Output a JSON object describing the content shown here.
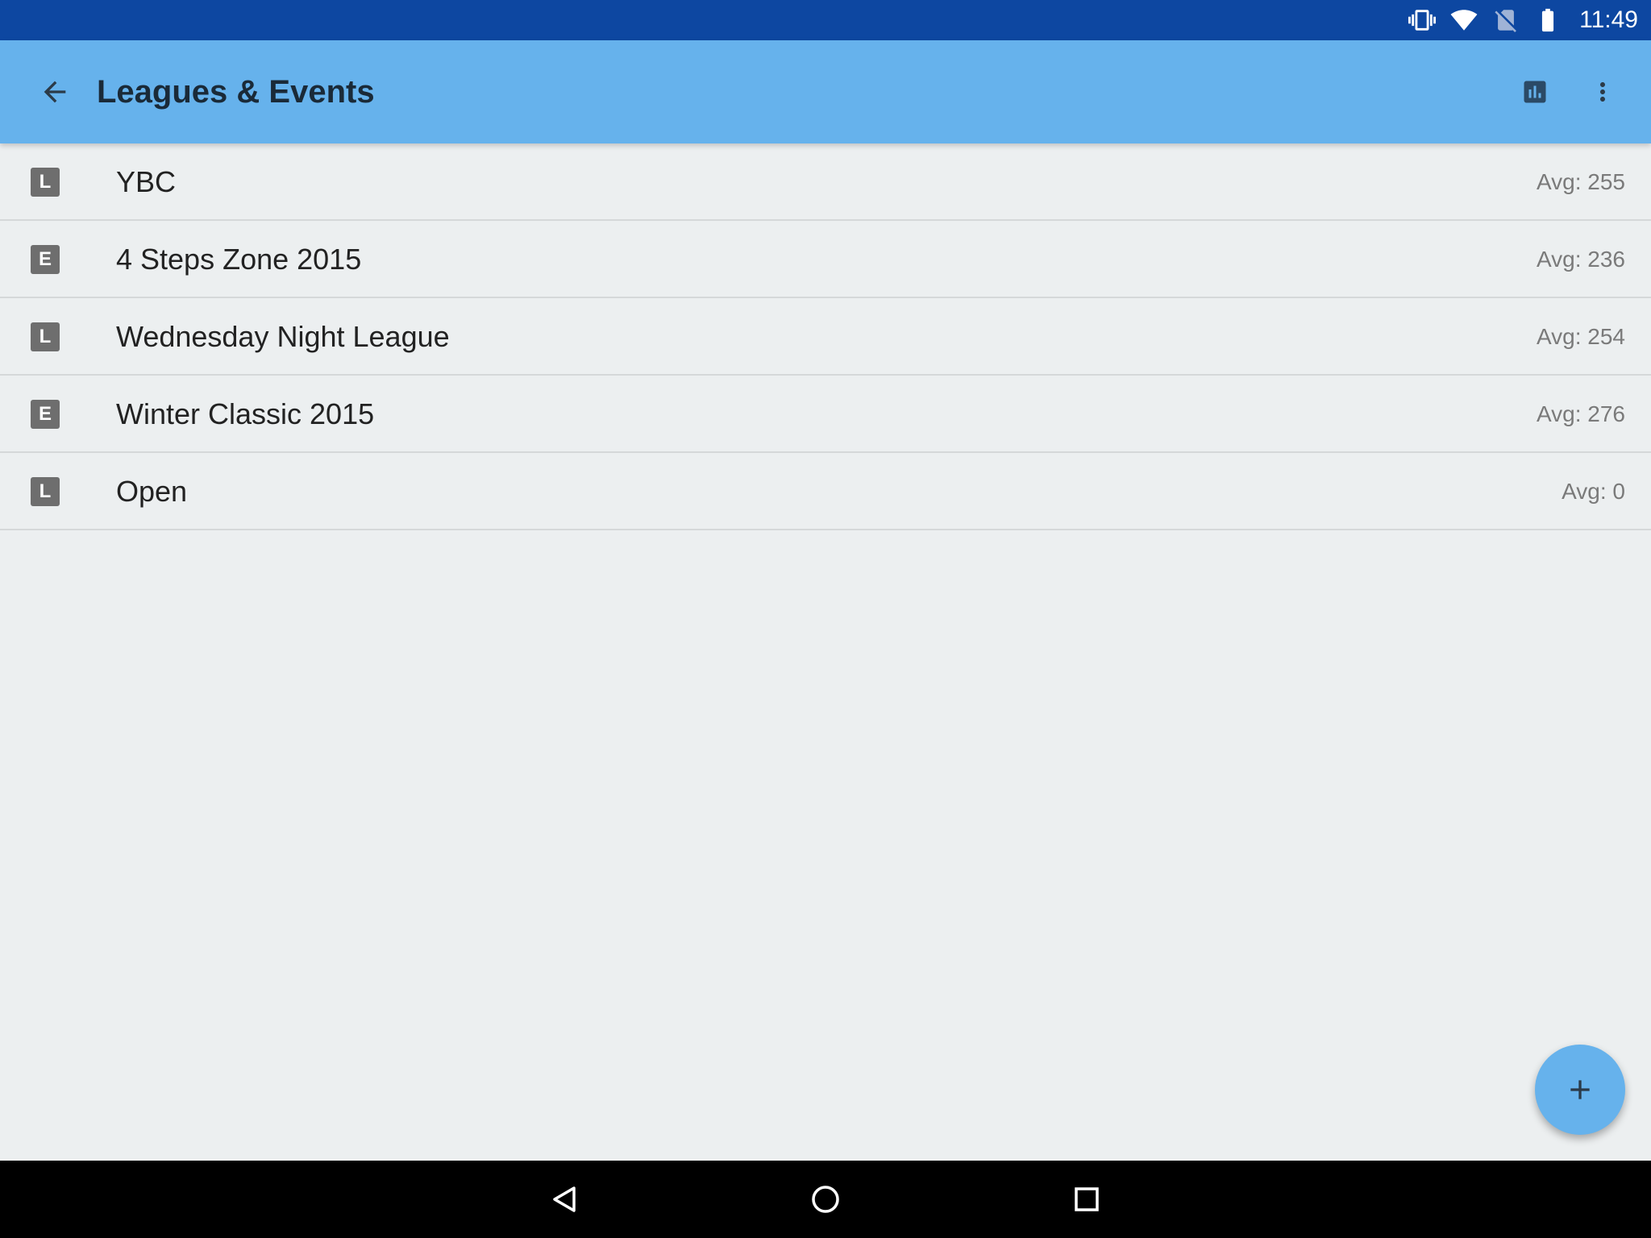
{
  "status_bar": {
    "time": "11:49",
    "icons": [
      "vibrate-icon",
      "wifi-icon",
      "no-sim-icon",
      "battery-icon"
    ],
    "background": "#0D47A1"
  },
  "app_bar": {
    "title": "Leagues & Events",
    "back_icon": "arrow-back-icon",
    "actions": [
      "stats-icon",
      "more-vert-icon"
    ],
    "background": "#66B2EC"
  },
  "items": [
    {
      "type": "L",
      "name": "YBC",
      "avg": "Avg: 255"
    },
    {
      "type": "E",
      "name": "4 Steps Zone 2015",
      "avg": "Avg: 236"
    },
    {
      "type": "L",
      "name": "Wednesday Night League",
      "avg": "Avg: 254"
    },
    {
      "type": "E",
      "name": "Winter Classic 2015",
      "avg": "Avg: 276"
    },
    {
      "type": "L",
      "name": "Open",
      "avg": "Avg: 0"
    }
  ],
  "fab": {
    "icon": "add-icon",
    "color": "#66B2EC"
  },
  "nav_bar": {
    "icons": [
      "back-triangle-icon",
      "home-circle-icon",
      "recents-square-icon"
    ]
  }
}
